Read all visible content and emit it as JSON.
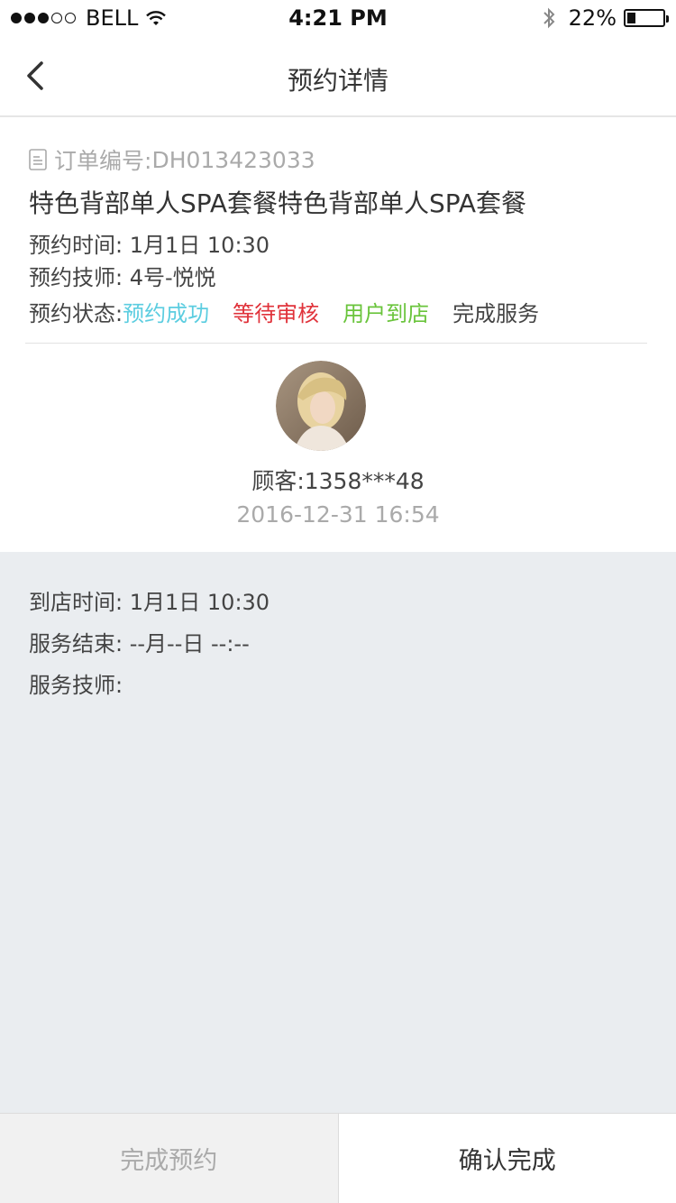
{
  "status_bar": {
    "carrier": "BELL",
    "time": "4:21 PM",
    "battery_percent": "22%",
    "battery_level": 0.22,
    "signal_bars": 3,
    "signal_max": 5
  },
  "nav": {
    "title": "预约详情",
    "back_icon": "chevron-left-icon"
  },
  "order": {
    "number_label": "订单编号:",
    "number_value": "DH013423033",
    "title": "特色背部单人SPA套餐特色背部单人SPA套餐",
    "time_label": "预约时间:",
    "time_value": "1月1日 10:30",
    "tech_label": "预约技师:",
    "tech_value": "4号-悦悦",
    "status_label": "预约状态:",
    "statuses": [
      "预约成功",
      "等待审核",
      "用户到店",
      "完成服务"
    ]
  },
  "customer": {
    "label": "顾客:",
    "phone": "1358***48",
    "datetime": "2016-12-31 16:54"
  },
  "service": {
    "arrival_label": "到店时间:",
    "arrival_value": "1月1日 10:30",
    "end_label": "服务结束:",
    "end_value": "--月--日 --:--",
    "tech_label": "服务技师:",
    "tech_value": ""
  },
  "actions": {
    "complete_booking": "完成预约",
    "confirm_complete": "确认完成"
  },
  "colors": {
    "status_success": "#5ccde0",
    "status_pending": "#e0323a",
    "status_arrived": "#6ac43c",
    "status_done": "#444444",
    "section_bg": "#eaedf0"
  }
}
